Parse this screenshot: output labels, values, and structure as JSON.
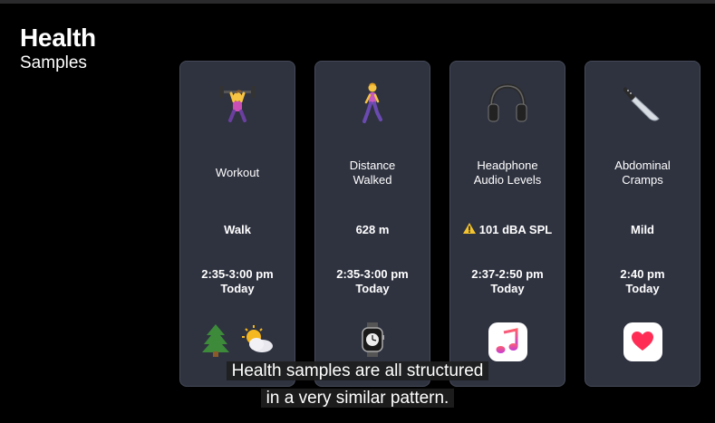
{
  "header": {
    "title": "Health",
    "subtitle": "Samples"
  },
  "cards": [
    {
      "type_lines": [
        "Workout",
        ""
      ],
      "value": "Walk",
      "time_lines": [
        "2:35-3:00 pm",
        "Today"
      ],
      "icon": "weightlifter-icon",
      "sources": [
        "tree-icon",
        "sun-behind-cloud-icon"
      ]
    },
    {
      "type_lines": [
        "Distance",
        "Walked"
      ],
      "value": "628 m",
      "time_lines": [
        "2:35-3:00 pm",
        "Today"
      ],
      "icon": "walking-person-icon",
      "sources": [
        "apple-watch-icon"
      ]
    },
    {
      "type_lines": [
        "Headphone",
        "Audio Levels"
      ],
      "value": "101 dBA SPL",
      "value_prefix_icon": "warning-icon",
      "time_lines": [
        "2:37-2:50 pm",
        "Today"
      ],
      "icon": "headphones-icon",
      "sources": [
        "music-app-icon"
      ]
    },
    {
      "type_lines": [
        "Abdominal",
        "Cramps"
      ],
      "value": "Mild",
      "time_lines": [
        "2:40 pm",
        "Today"
      ],
      "icon": "knife-icon",
      "sources": [
        "health-app-icon"
      ]
    }
  ],
  "caption": {
    "line1": "Health samples are all structured",
    "line2": "in a very similar pattern."
  },
  "colors": {
    "card_bg": "#2f3340",
    "warning": "#f4c430",
    "music_gradient_top": "#ff5f6d",
    "heart": "#ff2d55"
  }
}
